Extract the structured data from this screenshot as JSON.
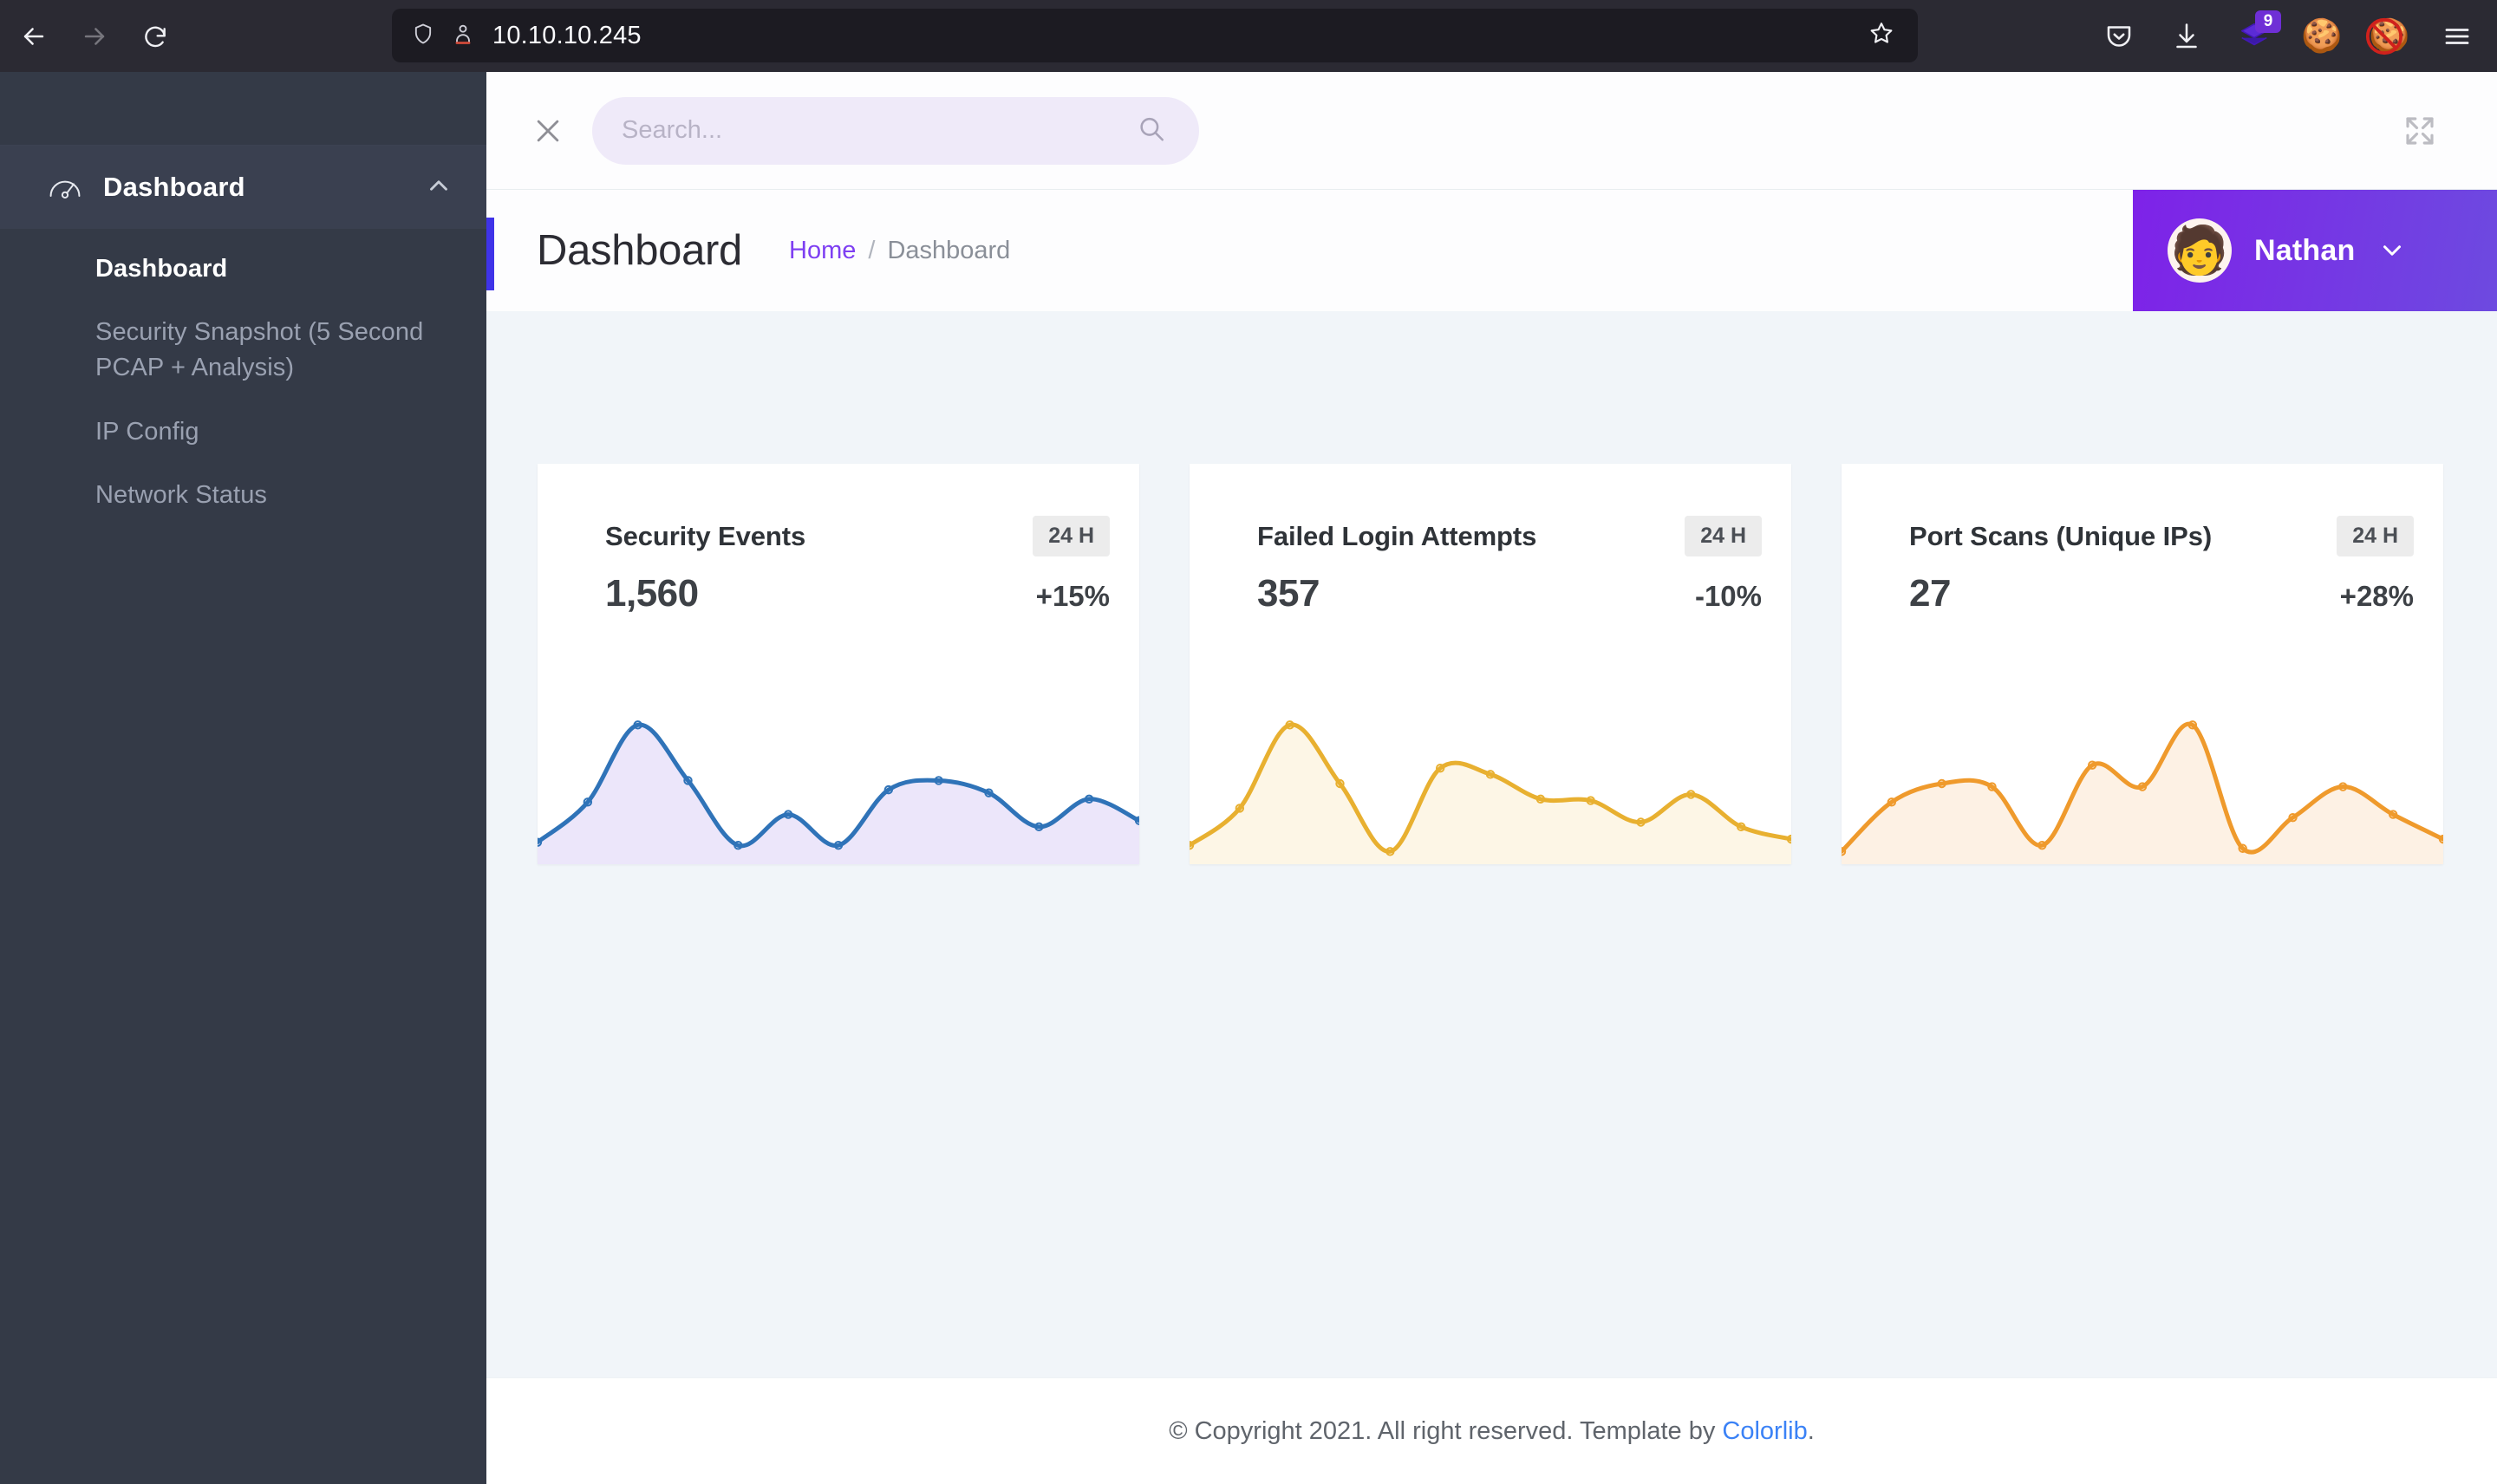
{
  "browser": {
    "back_icon": "arrow-left-icon",
    "forward_icon": "arrow-right-icon",
    "reload_icon": "reload-icon",
    "shield_icon": "shield-icon",
    "permissions_icon": "permissions-icon",
    "url": "10.10.10.245",
    "bookmark_icon": "star-icon",
    "pocket_icon": "pocket-icon",
    "downloads_icon": "download-icon",
    "extension_icon": "layers-extension-icon",
    "extension_badge": "9",
    "cookie_icon": "cookie-icon",
    "nocookie_icon": "no-cookie-icon",
    "menu_icon": "hamburger-menu-icon"
  },
  "sidebar": {
    "brand": {
      "icon": "speedometer-icon",
      "label": "Dashboard",
      "collapse_icon": "chevron-up-icon"
    },
    "items": [
      {
        "label": "Dashboard",
        "active": true
      },
      {
        "label": "Security Snapshot (5 Second PCAP + Analysis)",
        "active": false
      },
      {
        "label": "IP Config",
        "active": false
      },
      {
        "label": "Network Status",
        "active": false
      }
    ]
  },
  "search": {
    "close_icon": "close-icon",
    "placeholder": "Search...",
    "value": "",
    "magnifier_icon": "search-icon",
    "fullscreen_icon": "fullscreen-expand-icon"
  },
  "header": {
    "title": "Dashboard",
    "breadcrumb": {
      "home": "Home",
      "separator": "/",
      "current": "Dashboard"
    },
    "user": {
      "avatar_icon": "user-avatar",
      "avatar_emoji": "🧑",
      "name": "Nathan",
      "caret_icon": "chevron-down-icon"
    },
    "accent_color": "#3f33e8",
    "user_chip_color": "#7e22e8"
  },
  "cards": [
    {
      "title": "Security Events",
      "period": "24 H",
      "value": "1,560",
      "delta": "+15%",
      "line_color": "#2f73b8",
      "fill_color": "#ece6fa"
    },
    {
      "title": "Failed Login Attempts",
      "period": "24 H",
      "value": "357",
      "delta": "-10%",
      "line_color": "#e8b030",
      "fill_color": "#fdf6e6"
    },
    {
      "title": "Port Scans (Unique IPs)",
      "period": "24 H",
      "value": "27",
      "delta": "+28%",
      "line_color": "#ef9a2c",
      "fill_color": "#fdf1e4"
    }
  ],
  "chart_data": [
    {
      "type": "area",
      "title": "Security Events",
      "series": [
        {
          "name": "Security Events",
          "values": [
            12,
            38,
            88,
            52,
            10,
            30,
            10,
            46,
            52,
            44,
            22,
            40,
            26
          ]
        }
      ],
      "x": [
        0,
        1,
        2,
        3,
        4,
        5,
        6,
        7,
        8,
        9,
        10,
        11,
        12
      ],
      "ylim": [
        0,
        100
      ],
      "xlabel": "",
      "ylabel": "",
      "grid": false,
      "legend": "none",
      "line_color": "#2f73b8",
      "fill_color": "#ece6fa"
    },
    {
      "type": "area",
      "title": "Failed Login Attempts",
      "series": [
        {
          "name": "Failed Login Attempts",
          "values": [
            10,
            34,
            88,
            50,
            6,
            60,
            56,
            40,
            39,
            25,
            43,
            22,
            14
          ]
        }
      ],
      "x": [
        0,
        1,
        2,
        3,
        4,
        5,
        6,
        7,
        8,
        9,
        10,
        11,
        12
      ],
      "ylim": [
        0,
        100
      ],
      "xlabel": "",
      "ylabel": "",
      "grid": false,
      "legend": "none",
      "line_color": "#e8b030",
      "fill_color": "#fdf6e6"
    },
    {
      "type": "area",
      "title": "Port Scans (Unique IPs)",
      "series": [
        {
          "name": "Port Scans (Unique IPs)",
          "values": [
            6,
            38,
            50,
            48,
            10,
            62,
            48,
            88,
            8,
            28,
            48,
            30,
            14
          ]
        }
      ],
      "x": [
        0,
        1,
        2,
        3,
        4,
        5,
        6,
        7,
        8,
        9,
        10,
        11,
        12
      ],
      "ylim": [
        0,
        100
      ],
      "xlabel": "",
      "ylabel": "",
      "grid": false,
      "legend": "none",
      "line_color": "#ef9a2c",
      "fill_color": "#fdf1e4"
    }
  ],
  "footer": {
    "text": "© Copyright 2021. All right reserved. Template by ",
    "link": "Colorlib",
    "suffix": "."
  }
}
